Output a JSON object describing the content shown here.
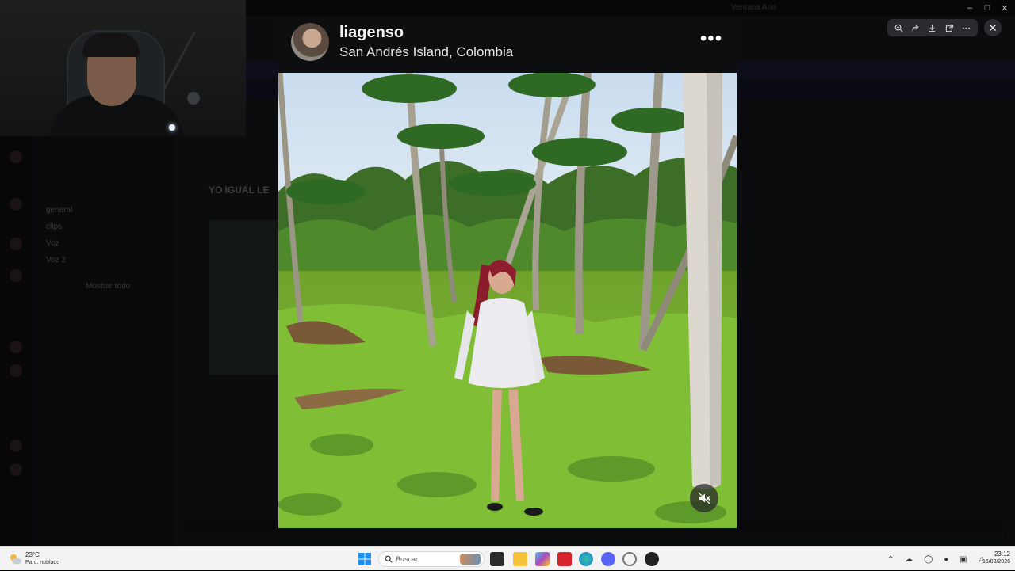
{
  "window": {
    "title": "Ventana Ario",
    "controls": [
      "minimize",
      "maximize",
      "close"
    ]
  },
  "background_app": {
    "heading": "YO IGUAL LE",
    "channels": [
      "general",
      "clips",
      "Voz",
      "Voz 2"
    ],
    "show_all": "Mostrar todo"
  },
  "post": {
    "username": "liagenso",
    "location": "San Andrés Island, Colombia",
    "more_icon": "more-horizontal-icon",
    "mute_icon": "volume-muted-icon"
  },
  "viewer_toolbar": {
    "icons": [
      "zoom-in-icon",
      "share-icon",
      "download-icon",
      "open-external-icon",
      "more-icon"
    ],
    "close_icon": "close-icon"
  },
  "taskbar": {
    "weather": {
      "temp": "23°C",
      "desc": "Parc. nublado"
    },
    "search_placeholder": "Buscar",
    "clock": {
      "time": "23:12",
      "date": "16/03/2026"
    }
  },
  "colors": {
    "viewer_header_bg": "#0d0e10",
    "taskbar_bg": "#f3f3f3",
    "accent": "#0067c0"
  }
}
